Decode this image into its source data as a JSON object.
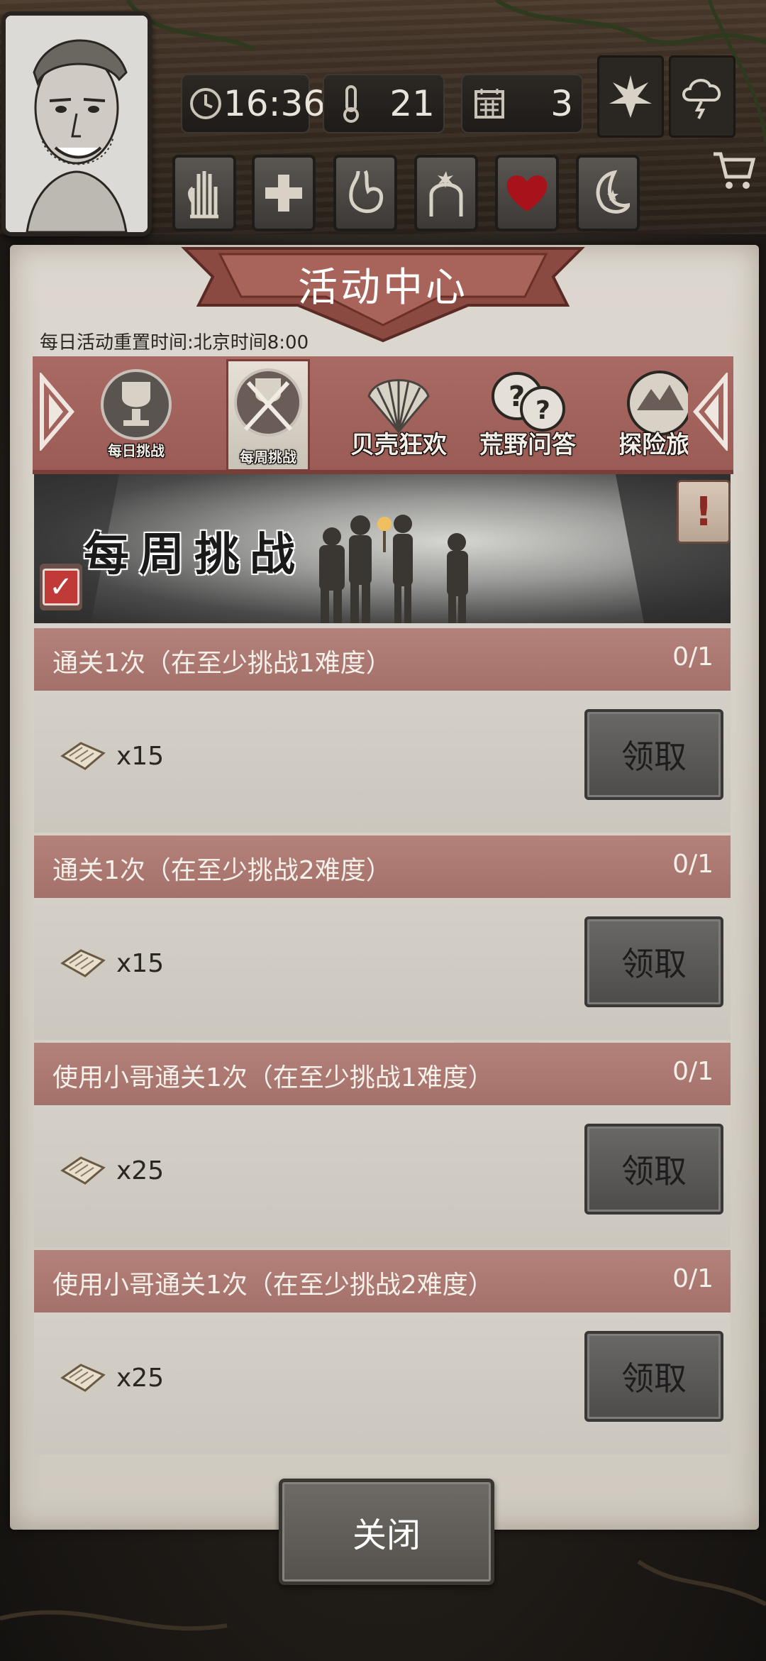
{
  "hud": {
    "time": "16:36",
    "temperature": "21",
    "day": "3",
    "icons": [
      "clock-icon",
      "thermometer-icon",
      "calendar-icon",
      "leaf-icon",
      "storm-cloud-icon",
      "cart-icon"
    ],
    "needs": [
      "hand-icon",
      "health-cross-icon",
      "stomach-icon",
      "head-icon",
      "heart-icon",
      "moon-icon"
    ]
  },
  "panel": {
    "title": "活动中心",
    "reset_time": "每日活动重置时间:北京时间8:00"
  },
  "tabs": [
    {
      "label": "每日挑战",
      "icon": "trophy-icon",
      "active": false
    },
    {
      "label": "每周挑战",
      "icon": "weapons-trophy-icon",
      "active": true
    },
    {
      "label": "贝壳狂欢",
      "icon": "shell-icon",
      "active": false
    },
    {
      "label": "荒野问答",
      "icon": "question-bubbles-icon",
      "active": false
    },
    {
      "label": "探险旅",
      "icon": "explore-icon",
      "active": false
    }
  ],
  "hero": {
    "title": "每周挑战",
    "checked": true
  },
  "quests": [
    {
      "title": "通关1次（在至少挑战1难度）",
      "progress": "0/1",
      "reward_qty": "x15",
      "button": "领取"
    },
    {
      "title": "通关1次（在至少挑战2难度）",
      "progress": "0/1",
      "reward_qty": "x15",
      "button": "领取"
    },
    {
      "title": "使用小哥通关1次（在至少挑战1难度）",
      "progress": "0/1",
      "reward_qty": "x25",
      "button": "领取"
    },
    {
      "title": "使用小哥通关1次（在至少挑战2难度）",
      "progress": "0/1",
      "reward_qty": "x25",
      "button": "领取"
    }
  ],
  "close_button": "关闭",
  "colors": {
    "header_rose": "#a4716a",
    "tab_strip": "#9a5c54",
    "parchment": "#d6d1c8",
    "button_gray": "#55524e",
    "check_red": "#c03a38"
  }
}
